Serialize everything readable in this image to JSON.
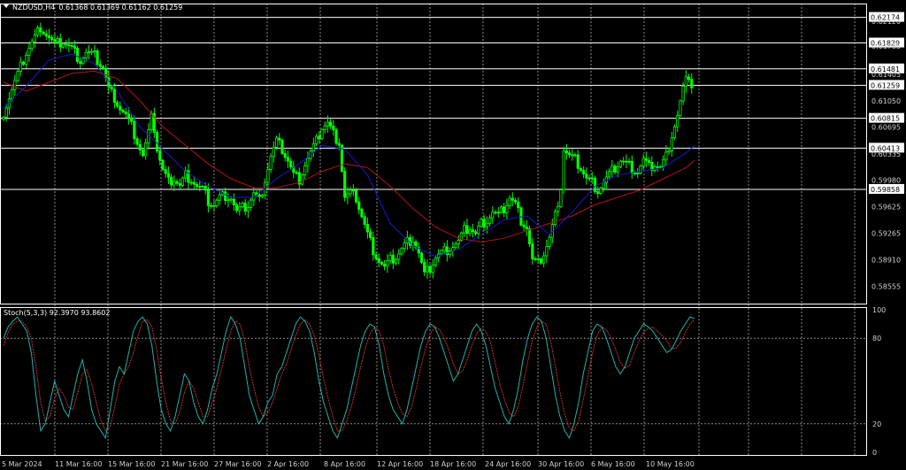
{
  "header": {
    "symbol": "NZDUSD,H4",
    "ohlc": "0.61368 0.61369 0.61162 0.61259"
  },
  "stoch_header": "Stoch(5,3,3) 92.3970 93.8602",
  "colors": {
    "background": "#000000",
    "bull_candle": "#00ff00",
    "bear_candle": "#00ff00",
    "ma_fast": "#1a1acd",
    "ma_slow": "#b41414",
    "stoch_main": "#20b2aa",
    "stoch_signal": "#c83232",
    "level_line": "#ffffff",
    "grid": "#8a8a8a"
  },
  "chart_data": {
    "type": "candlestick",
    "price_axis_ticks": [
      "0.62120",
      "0.61785",
      "0.61405",
      "0.61050",
      "0.60695",
      "0.60335",
      "0.59980",
      "0.59625",
      "0.59265",
      "0.58910",
      "0.58555"
    ],
    "price_levels": [
      "0.62174",
      "0.61829",
      "0.61481",
      "0.61259",
      "0.60815",
      "0.60413",
      "0.59858"
    ],
    "ylim": [
      0.5832,
      0.6236
    ],
    "time_labels": [
      "5 Mar 2024",
      "11 Mar 16:00",
      "15 Mar 16:00",
      "21 Mar 16:00",
      "27 Mar 16:00",
      "2 Apr 16:00",
      "8 Apr 16:00",
      "12 Apr 16:00",
      "18 Apr 16:00",
      "24 Apr 16:00",
      "30 Apr 16:00",
      "6 May 16:00",
      "10 May 16:00"
    ],
    "close_path": [
      [
        0,
        0.608
      ],
      [
        3,
        0.611
      ],
      [
        6,
        0.614
      ],
      [
        9,
        0.617
      ],
      [
        12,
        0.619
      ],
      [
        14,
        0.6205
      ],
      [
        16,
        0.6195
      ],
      [
        19,
        0.618
      ],
      [
        22,
        0.6185
      ],
      [
        25,
        0.6175
      ],
      [
        28,
        0.616
      ],
      [
        30,
        0.617
      ],
      [
        33,
        0.6165
      ],
      [
        36,
        0.615
      ],
      [
        38,
        0.612
      ],
      [
        40,
        0.611
      ],
      [
        42,
        0.6095
      ],
      [
        44,
        0.6085
      ],
      [
        46,
        0.607
      ],
      [
        48,
        0.605
      ],
      [
        50,
        0.603
      ],
      [
        52,
        0.606
      ],
      [
        53,
        0.6095
      ],
      [
        55,
        0.604
      ],
      [
        57,
        0.601
      ],
      [
        59,
        0.5995
      ],
      [
        61,
        0.6
      ],
      [
        63,
        0.599
      ],
      [
        65,
        0.6005
      ],
      [
        67,
        0.6
      ],
      [
        69,
        0.599
      ],
      [
        71,
        0.5985
      ],
      [
        73,
        0.597
      ],
      [
        75,
        0.5965
      ],
      [
        77,
        0.5975
      ],
      [
        79,
        0.5978
      ],
      [
        81,
        0.5975
      ],
      [
        83,
        0.5955
      ],
      [
        85,
        0.596
      ],
      [
        87,
        0.5965
      ],
      [
        89,
        0.598
      ],
      [
        91,
        0.597
      ],
      [
        93,
        0.6
      ],
      [
        95,
        0.603
      ],
      [
        97,
        0.605
      ],
      [
        99,
        0.604
      ],
      [
        101,
        0.6025
      ],
      [
        103,
        0.6005
      ],
      [
        105,
        0.6
      ],
      [
        107,
        0.602
      ],
      [
        109,
        0.6035
      ],
      [
        111,
        0.605
      ],
      [
        113,
        0.607
      ],
      [
        115,
        0.6075
      ],
      [
        117,
        0.606
      ],
      [
        119,
        0.605
      ],
      [
        121,
        0.5975
      ],
      [
        123,
        0.598
      ],
      [
        125,
        0.5975
      ],
      [
        127,
        0.595
      ],
      [
        129,
        0.5925
      ],
      [
        131,
        0.5905
      ],
      [
        133,
        0.589
      ],
      [
        135,
        0.588
      ],
      [
        137,
        0.589
      ],
      [
        139,
        0.5895
      ],
      [
        141,
        0.5905
      ],
      [
        143,
        0.5915
      ],
      [
        145,
        0.592
      ],
      [
        147,
        0.59
      ],
      [
        149,
        0.587
      ],
      [
        151,
        0.588
      ],
      [
        153,
        0.5895
      ],
      [
        155,
        0.59
      ],
      [
        157,
        0.5905
      ],
      [
        159,
        0.591
      ],
      [
        161,
        0.5915
      ],
      [
        163,
        0.593
      ],
      [
        165,
        0.5935
      ],
      [
        167,
        0.5925
      ],
      [
        169,
        0.594
      ],
      [
        171,
        0.5945
      ],
      [
        173,
        0.5955
      ],
      [
        175,
        0.595
      ],
      [
        177,
        0.596
      ],
      [
        179,
        0.5975
      ],
      [
        181,
        0.5965
      ],
      [
        183,
        0.5945
      ],
      [
        185,
        0.5935
      ],
      [
        187,
        0.589
      ],
      [
        189,
        0.5885
      ],
      [
        191,
        0.59
      ],
      [
        193,
        0.592
      ],
      [
        195,
        0.595
      ],
      [
        197,
        0.599
      ],
      [
        198,
        0.604
      ],
      [
        200,
        0.603
      ],
      [
        202,
        0.6025
      ],
      [
        204,
        0.6015
      ],
      [
        206,
        0.6
      ],
      [
        208,
        0.5995
      ],
      [
        210,
        0.5985
      ],
      [
        212,
        0.5995
      ],
      [
        214,
        0.6005
      ],
      [
        216,
        0.6015
      ],
      [
        218,
        0.6025
      ],
      [
        220,
        0.602
      ],
      [
        222,
        0.6015
      ],
      [
        224,
        0.601
      ],
      [
        226,
        0.6025
      ],
      [
        228,
        0.6015
      ],
      [
        230,
        0.602
      ],
      [
        232,
        0.6015
      ],
      [
        234,
        0.603
      ],
      [
        236,
        0.606
      ],
      [
        238,
        0.6085
      ],
      [
        240,
        0.612
      ],
      [
        242,
        0.614
      ],
      [
        243,
        0.6126
      ]
    ],
    "ma_fast_path": [
      [
        0,
        0.6095
      ],
      [
        8,
        0.6125
      ],
      [
        16,
        0.616
      ],
      [
        24,
        0.6168
      ],
      [
        32,
        0.6155
      ],
      [
        40,
        0.6118
      ],
      [
        48,
        0.607
      ],
      [
        56,
        0.604
      ],
      [
        64,
        0.601
      ],
      [
        72,
        0.599
      ],
      [
        80,
        0.5975
      ],
      [
        88,
        0.5975
      ],
      [
        96,
        0.6
      ],
      [
        104,
        0.602
      ],
      [
        112,
        0.6045
      ],
      [
        120,
        0.604
      ],
      [
        128,
        0.6005
      ],
      [
        136,
        0.594
      ],
      [
        144,
        0.591
      ],
      [
        152,
        0.5895
      ],
      [
        160,
        0.5905
      ],
      [
        168,
        0.5925
      ],
      [
        176,
        0.5945
      ],
      [
        184,
        0.595
      ],
      [
        192,
        0.5925
      ],
      [
        200,
        0.5955
      ],
      [
        208,
        0.599
      ],
      [
        216,
        0.6005
      ],
      [
        224,
        0.601
      ],
      [
        232,
        0.6015
      ],
      [
        240,
        0.6035
      ],
      [
        243,
        0.6045
      ]
    ],
    "ma_slow_path": [
      [
        0,
        0.613
      ],
      [
        8,
        0.6118
      ],
      [
        16,
        0.613
      ],
      [
        24,
        0.6142
      ],
      [
        32,
        0.6145
      ],
      [
        40,
        0.6135
      ],
      [
        48,
        0.6105
      ],
      [
        56,
        0.607
      ],
      [
        64,
        0.6045
      ],
      [
        72,
        0.602
      ],
      [
        80,
        0.6
      ],
      [
        88,
        0.5988
      ],
      [
        96,
        0.5988
      ],
      [
        104,
        0.5995
      ],
      [
        112,
        0.601
      ],
      [
        120,
        0.602
      ],
      [
        128,
        0.6015
      ],
      [
        136,
        0.599
      ],
      [
        144,
        0.596
      ],
      [
        152,
        0.5935
      ],
      [
        160,
        0.592
      ],
      [
        168,
        0.5915
      ],
      [
        176,
        0.592
      ],
      [
        184,
        0.593
      ],
      [
        192,
        0.594
      ],
      [
        200,
        0.595
      ],
      [
        208,
        0.5965
      ],
      [
        216,
        0.5975
      ],
      [
        224,
        0.5985
      ],
      [
        232,
        0.6
      ],
      [
        240,
        0.6015
      ],
      [
        243,
        0.6025
      ]
    ],
    "stoch_ticks": [
      "100",
      "80",
      "20",
      "0"
    ],
    "stoch_levels": [
      80,
      20
    ],
    "stoch_main_values": [
      80,
      88,
      92,
      95,
      90,
      85,
      70,
      40,
      15,
      20,
      35,
      50,
      40,
      30,
      25,
      40,
      55,
      65,
      50,
      30,
      20,
      15,
      10,
      30,
      50,
      60,
      55,
      70,
      85,
      92,
      95,
      90,
      75,
      50,
      30,
      20,
      15,
      25,
      40,
      55,
      50,
      35,
      25,
      20,
      30,
      45,
      55,
      70,
      85,
      95,
      90,
      80,
      60,
      40,
      30,
      20,
      25,
      35,
      40,
      55,
      60,
      70,
      80,
      90,
      95,
      92,
      85,
      70,
      50,
      35,
      25,
      15,
      10,
      20,
      30,
      45,
      60,
      75,
      85,
      90,
      88,
      75,
      55,
      40,
      30,
      25,
      20,
      30,
      45,
      60,
      75,
      85,
      90,
      88,
      80,
      70,
      60,
      50,
      55,
      65,
      75,
      85,
      90,
      85,
      75,
      60,
      45,
      35,
      25,
      20,
      30,
      45,
      65,
      80,
      90,
      95,
      92,
      80,
      60,
      40,
      25,
      15,
      10,
      20,
      35,
      55,
      70,
      85,
      90,
      88,
      80,
      70,
      60,
      55,
      60,
      70,
      80,
      85,
      90,
      88,
      85,
      80,
      75,
      70,
      72,
      78,
      85,
      90,
      95,
      94
    ],
    "stoch_signal_values": [
      75,
      84,
      90,
      92,
      92,
      88,
      80,
      60,
      35,
      22,
      25,
      38,
      45,
      40,
      32,
      30,
      42,
      55,
      58,
      48,
      35,
      22,
      15,
      18,
      32,
      48,
      55,
      60,
      70,
      82,
      92,
      93,
      88,
      72,
      52,
      35,
      22,
      20,
      28,
      42,
      50,
      45,
      35,
      25,
      25,
      35,
      45,
      58,
      72,
      85,
      92,
      90,
      78,
      60,
      45,
      32,
      25,
      28,
      35,
      45,
      55,
      62,
      72,
      82,
      90,
      93,
      90,
      82,
      68,
      52,
      38,
      25,
      15,
      15,
      22,
      32,
      45,
      60,
      73,
      83,
      88,
      85,
      75,
      58,
      45,
      35,
      27,
      25,
      32,
      45,
      60,
      73,
      83,
      88,
      86,
      80,
      72,
      62,
      55,
      57,
      65,
      75,
      83,
      87,
      85,
      77,
      63,
      48,
      37,
      28,
      25,
      32,
      47,
      63,
      78,
      88,
      92,
      90,
      78,
      60,
      42,
      27,
      17,
      15,
      22,
      37,
      53,
      70,
      82,
      88,
      86,
      80,
      72,
      63,
      59,
      61,
      70,
      78,
      84,
      87,
      88,
      85,
      82,
      78,
      73,
      73,
      77,
      84,
      90,
      93
    ]
  }
}
